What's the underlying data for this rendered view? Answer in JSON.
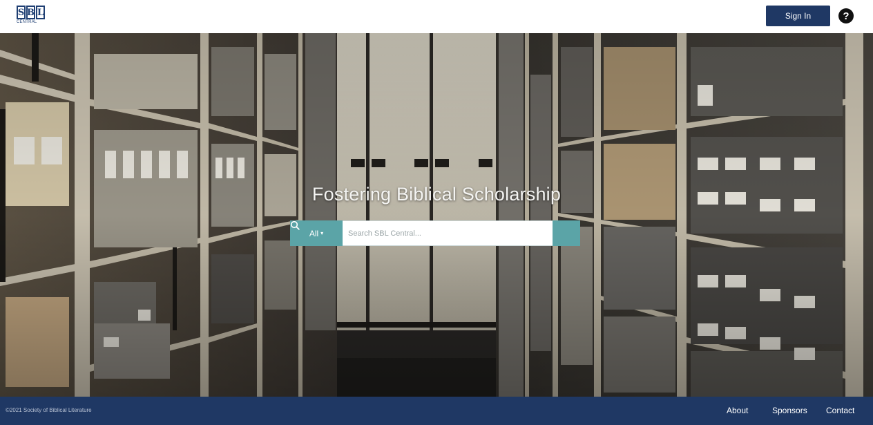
{
  "header": {
    "logo_letters": [
      "S",
      "B",
      "L"
    ],
    "logo_subtitle": "CENTRAL",
    "signin_label": "Sign In",
    "help_symbol": "?"
  },
  "hero": {
    "title": "Fostering Biblical Scholarship",
    "search": {
      "scope_selected": "All",
      "placeholder": "Search SBL Central...",
      "value": "",
      "search_icon": "magnifier-icon"
    }
  },
  "footer": {
    "copyright": "©2021 Society of Biblical Literature",
    "links": [
      "About",
      "Sponsors",
      "Contact"
    ]
  },
  "colors": {
    "brand_navy": "#1f3864",
    "accent_teal": "#5ba4a7",
    "shelf_beige": "#c9c1ae"
  }
}
